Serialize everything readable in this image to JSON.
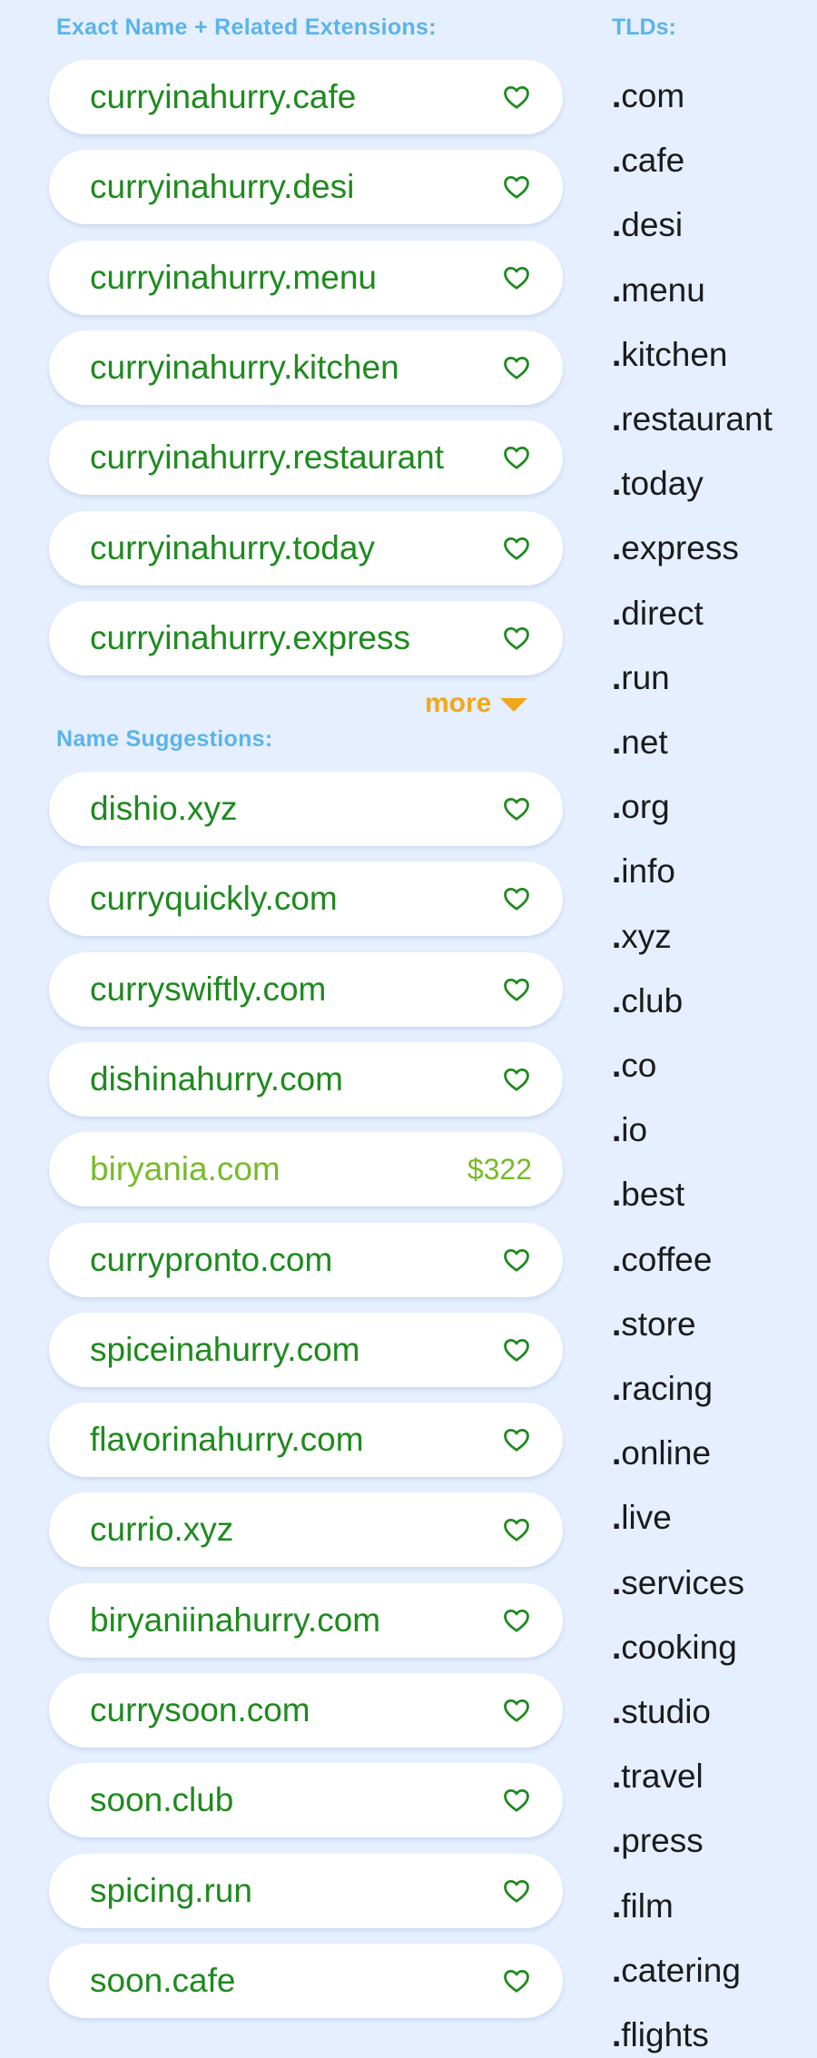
{
  "sections": {
    "exact_label": "Exact Name + Related Extensions:",
    "suggestions_label": "Name Suggestions:",
    "tlds_label": "TLDs:"
  },
  "more_label": "more",
  "exact": [
    {
      "domain": "curryinahurry.cafe"
    },
    {
      "domain": "curryinahurry.desi"
    },
    {
      "domain": "curryinahurry.menu"
    },
    {
      "domain": "curryinahurry.kitchen"
    },
    {
      "domain": "curryinahurry.restaurant"
    },
    {
      "domain": "curryinahurry.today"
    },
    {
      "domain": "curryinahurry.express"
    }
  ],
  "suggestions": [
    {
      "domain": "dishio.xyz"
    },
    {
      "domain": "curryquickly.com"
    },
    {
      "domain": "curryswiftly.com"
    },
    {
      "domain": "dishinahurry.com"
    },
    {
      "domain": "biryania.com",
      "price": "$322"
    },
    {
      "domain": "currypronto.com"
    },
    {
      "domain": "spiceinahurry.com"
    },
    {
      "domain": "flavorinahurry.com"
    },
    {
      "domain": "currio.xyz"
    },
    {
      "domain": "biryaniinahurry.com"
    },
    {
      "domain": "currysoon.com"
    },
    {
      "domain": "soon.club"
    },
    {
      "domain": "spicing.run"
    },
    {
      "domain": "soon.cafe"
    }
  ],
  "tlds": [
    "com",
    "cafe",
    "desi",
    "menu",
    "kitchen",
    "restaurant",
    "today",
    "express",
    "direct",
    "run",
    "net",
    "org",
    "info",
    "xyz",
    "club",
    "co",
    "io",
    "best",
    "coffee",
    "store",
    "racing",
    "online",
    "live",
    "services",
    "cooking",
    "studio",
    "travel",
    "press",
    "film",
    "catering",
    "flights"
  ],
  "icons": {
    "favorite": "heart-outline-icon",
    "more": "triangle-down-icon"
  },
  "colors": {
    "background": "#e5efff",
    "label": "#5ab4ea",
    "domain": "#1e8a1e",
    "priced": "#77bb2a",
    "more": "#f0a81a",
    "tld": "#1b1b1b"
  }
}
